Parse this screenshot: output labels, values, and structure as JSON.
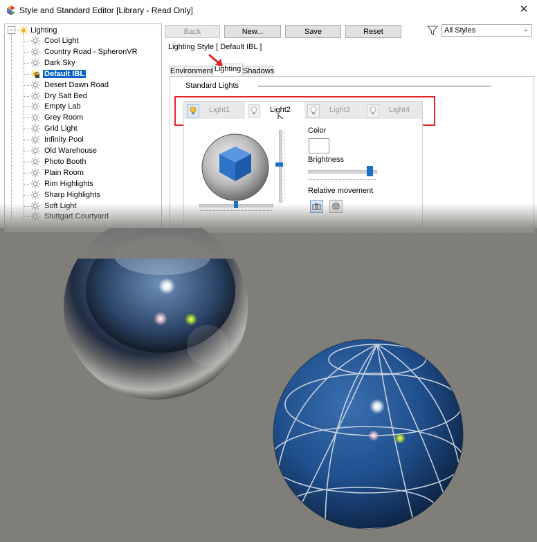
{
  "window": {
    "title": "Style and Standard Editor [Library - Read Only]",
    "close_glyph": "✕"
  },
  "tree": {
    "root_label": "Lighting",
    "expander": "−",
    "items": [
      {
        "label": "Cool Light"
      },
      {
        "label": "Country Road - SpheronVR"
      },
      {
        "label": "Dark Sky"
      },
      {
        "label": "Default IBL",
        "selected": true
      },
      {
        "label": "Desert Dawn Road"
      },
      {
        "label": "Dry Salt Bed"
      },
      {
        "label": "Empty Lab"
      },
      {
        "label": "Grey Room"
      },
      {
        "label": "Grid Light"
      },
      {
        "label": "Infinity Pool"
      },
      {
        "label": "Old Warehouse"
      },
      {
        "label": "Photo Booth"
      },
      {
        "label": "Plain Room"
      },
      {
        "label": "Rim Highlights"
      },
      {
        "label": "Sharp Highlights"
      },
      {
        "label": "Soft Light"
      },
      {
        "label": "Stuttgart Courtyard"
      }
    ]
  },
  "toolbar": {
    "back_label": "Back",
    "new_label": "New...",
    "save_label": "Save",
    "reset_label": "Reset",
    "filter_value": "All Styles"
  },
  "style_header": "Lighting Style [ Default IBL ]",
  "tabs": [
    {
      "label": "Environment"
    },
    {
      "label": "Lighting",
      "active": true
    },
    {
      "label": "Shadows"
    }
  ],
  "lighting": {
    "section_label": "Standard Lights",
    "lights": [
      {
        "label": "Light1",
        "on": true
      },
      {
        "label": "Light2",
        "selected": true
      },
      {
        "label": "Light3"
      },
      {
        "label": "Light4"
      }
    ],
    "color_label": "Color",
    "brightness_label": "Brightness",
    "relative_movement_label": "Relative movement"
  },
  "colors": {
    "accent": "#0a64c8",
    "highlight_border": "#e0242a",
    "render_background": "#7f7e79",
    "slider_thumb": "#1b6fc7"
  }
}
